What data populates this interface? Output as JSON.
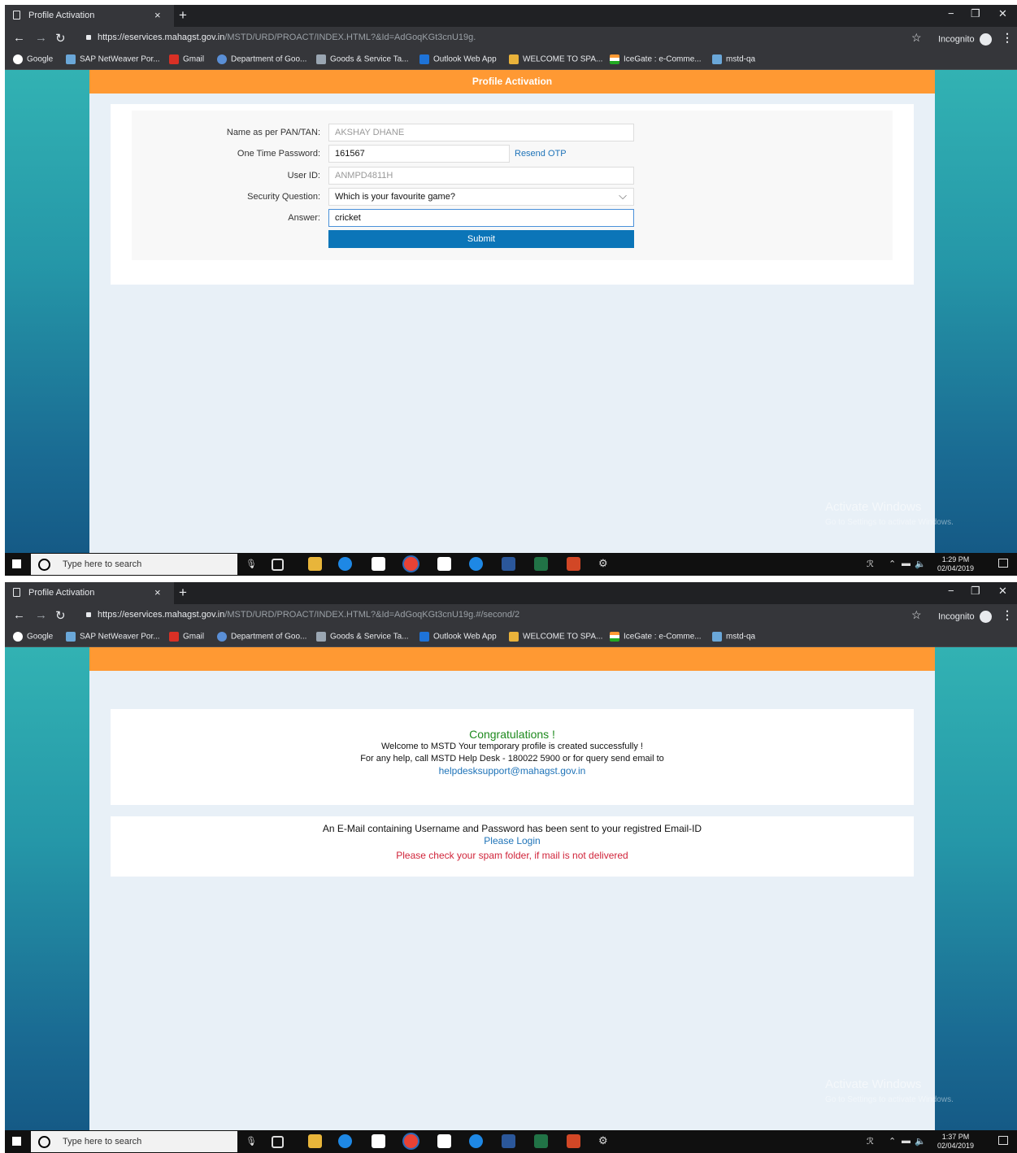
{
  "screens": [
    {
      "tab_title": "Profile Activation",
      "url_host": "https://eservices.mahagst.gov.in",
      "url_path": "/MSTD/URD/PROACT/INDEX.HTML?&Id=AdGoqKGt3cnU19g.",
      "incognito_label": "Incognito",
      "panel_title": "Profile Activation",
      "form": {
        "name_label": "Name as per PAN/TAN:",
        "name_value": "AKSHAY DHANE",
        "otp_label": "One Time Password:",
        "otp_value": "161567",
        "resend_label": "Resend OTP",
        "userid_label": "User ID:",
        "userid_value": "ANMPD4811H",
        "question_label": "Security Question:",
        "question_value": "Which is your favourite game?",
        "answer_label": "Answer:",
        "answer_value": "cricket",
        "submit_label": "Submit"
      },
      "watermark_title": "Activate Windows",
      "watermark_sub": "Go to Settings to activate Windows.",
      "clock_time": "1:29 PM",
      "clock_date": "02/04/2019"
    },
    {
      "tab_title": "Profile Activation",
      "url_host": "https://eservices.mahagst.gov.in",
      "url_path": "/MSTD/URD/PROACT/INDEX.HTML?&Id=AdGoqKGt3cnU19g.#/second/2",
      "incognito_label": "Incognito",
      "panel_title": "",
      "message": {
        "congrats": "Congratulations !",
        "welcome": "Welcome to MSTD Your temporary profile is created successfully !",
        "help": "For any help, call MSTD Help Desk - 180022 5900 or for query send email to",
        "email": "helpdesksupport@mahagst.gov.in",
        "email_sent": "An E-Mail containing Username and Password has been sent to your registred Email-ID",
        "login": "Please Login",
        "spam": "Please check your spam folder, if mail is not delivered"
      },
      "watermark_title": "Activate Windows",
      "watermark_sub": "Go to Settings to activate Windows.",
      "clock_time": "1:37 PM",
      "clock_date": "02/04/2019"
    }
  ],
  "bookmarks": [
    "Google",
    "SAP NetWeaver Por...",
    "Gmail",
    "Department of Goo...",
    "Goods & Service Ta...",
    "Outlook Web App",
    "WELCOME TO SPA...",
    "IceGate : e-Comme...",
    "mstd-qa"
  ],
  "taskbar": {
    "search_placeholder": "Type here to search"
  },
  "colors": {
    "banner": "#ff9933",
    "submit": "#0b75b8",
    "link": "#1e73b8",
    "success": "#1e8a1e",
    "warning": "#d0243a"
  }
}
